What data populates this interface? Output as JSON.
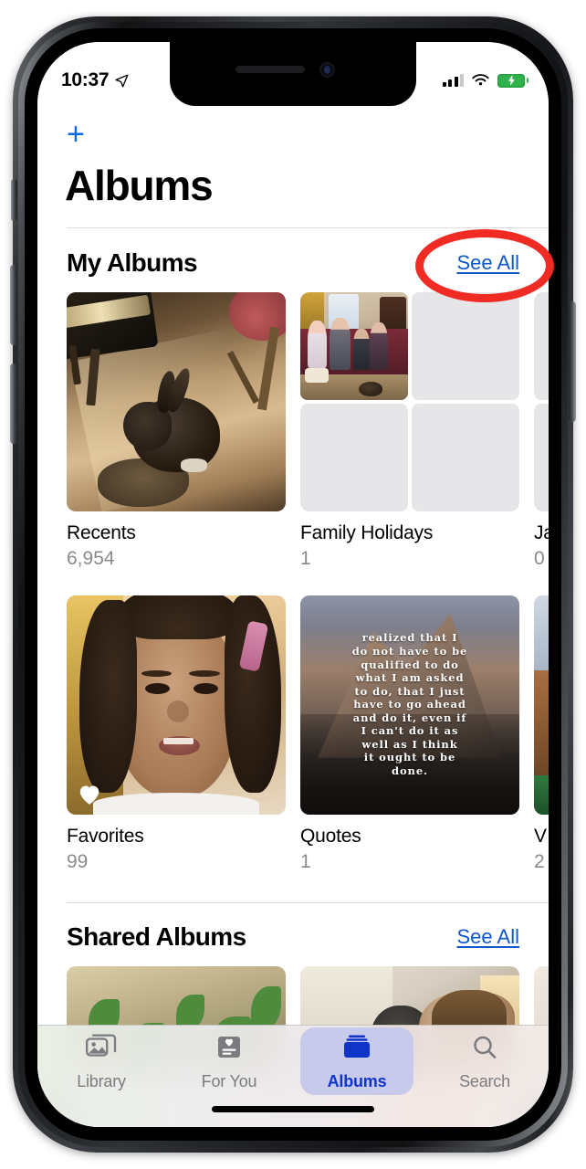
{
  "status_bar": {
    "time": "10:37",
    "location_icon": "location-arrow-icon",
    "signal_icon": "cellular-signal-icon",
    "signal_bars_filled": 3,
    "signal_bars_total": 4,
    "wifi_icon": "wifi-icon",
    "battery_icon": "battery-charging-icon",
    "battery_color": "#2fb14b"
  },
  "nav": {
    "add_label": "+",
    "add_icon": "plus-icon",
    "title": "Albums",
    "accent_color": "#0a6ae1"
  },
  "sections": [
    {
      "title": "My Albums",
      "see_all_label": "See All",
      "link_color": "#1057c8",
      "albums": [
        {
          "name": "Recents",
          "count": "6,954",
          "thumb": "rabbit-photo"
        },
        {
          "name": "Family Holidays",
          "count": "1",
          "thumb": "family-photo-grid"
        },
        {
          "name": "Ja",
          "count": "0",
          "thumb": "empty-grid",
          "clipped": true
        },
        {
          "name": "Favorites",
          "count": "99",
          "thumb": "child-photo",
          "badge_icon": "heart-icon"
        },
        {
          "name": "Quotes",
          "count": "1",
          "thumb": "quote-photo"
        },
        {
          "name": "V",
          "count": "2",
          "thumb": "vacation-photo",
          "clipped": true
        }
      ]
    },
    {
      "title": "Shared Albums",
      "see_all_label": "See All",
      "link_color": "#1057c8",
      "albums": [
        {
          "name": "",
          "count": "",
          "thumb": "garden-photo"
        },
        {
          "name": "",
          "count": "",
          "thumb": "dog-person-photo"
        },
        {
          "name": "",
          "count": "",
          "thumb": "third-photo",
          "clipped": true
        }
      ]
    }
  ],
  "quote_thumb": {
    "lines": [
      "realized that I",
      "do not have to be",
      "qualified to do",
      "what I am asked",
      "to do, that I just",
      "have to go ahead",
      "and do it, even if",
      "I can't do it as",
      "well as I think",
      "it ought to be",
      "done."
    ]
  },
  "tab_bar": {
    "active_index": 2,
    "active_color": "#1034c8",
    "inactive_color": "#7c7c80",
    "pill_color": "#c7caea",
    "tabs": [
      {
        "label": "Library",
        "icon": "photos-library-icon"
      },
      {
        "label": "For You",
        "icon": "for-you-heart-card-icon"
      },
      {
        "label": "Albums",
        "icon": "albums-folder-icon"
      },
      {
        "label": "Search",
        "icon": "search-magnifier-icon"
      }
    ]
  },
  "annotation": {
    "shape": "oval",
    "color": "#ef2b23",
    "targets": "See All"
  }
}
